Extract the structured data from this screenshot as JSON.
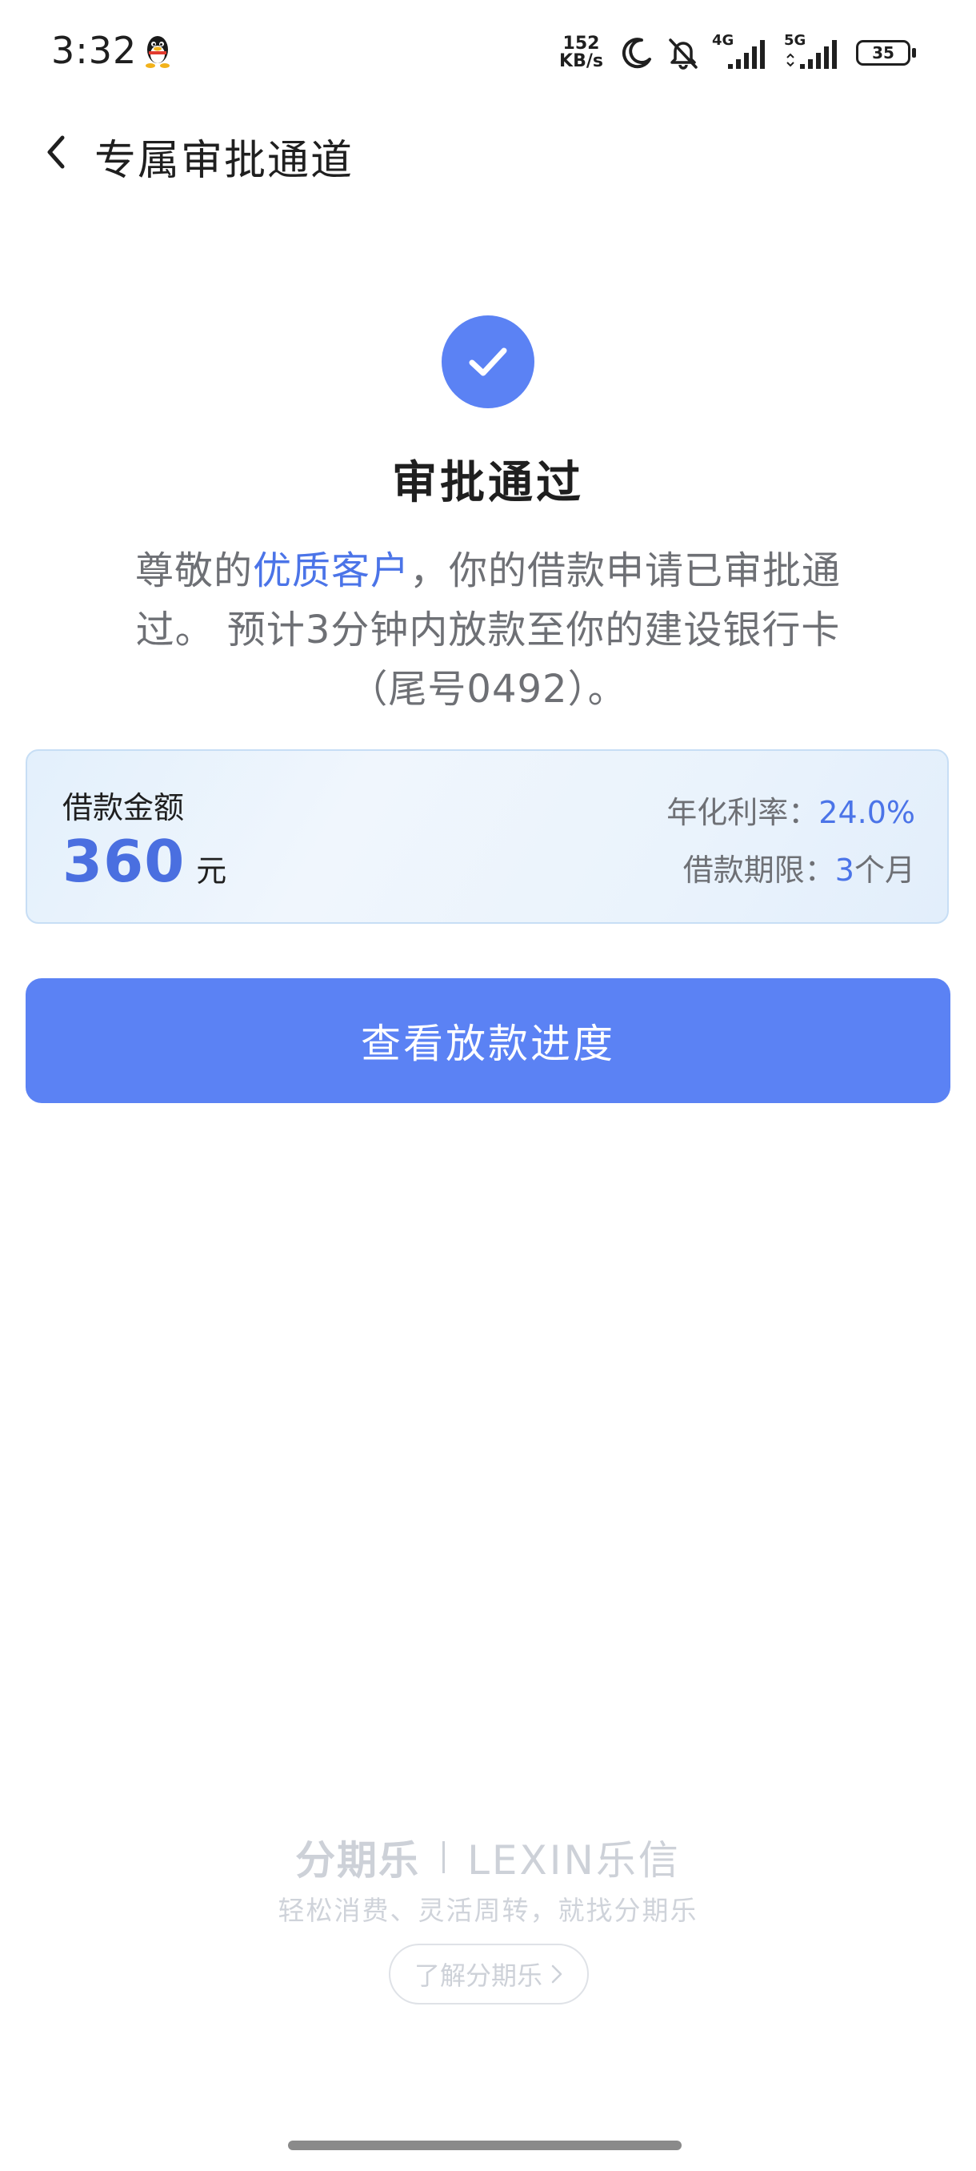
{
  "status_bar": {
    "time": "3:32",
    "net_speed_value": "152",
    "net_speed_unit": "KB/s",
    "signal_1_label": "4G",
    "signal_2_label": "5G",
    "battery": "35",
    "icons": [
      "qq-icon",
      "moon-icon",
      "bell-off-icon",
      "signal-icon",
      "signal-icon",
      "battery-icon"
    ]
  },
  "header": {
    "title": "专属审批通道"
  },
  "result": {
    "title": "审批通过",
    "desc_prefix": "尊敬的",
    "desc_highlight": "优质客户",
    "desc_suffix": "，你的借款申请已审批通过。 预计3分钟内放款至你的建设银行卡（尾号0492）。"
  },
  "loan": {
    "label": "借款金额",
    "amount": "360",
    "unit": "元",
    "rate_label": "年化利率：",
    "rate_value": "24.0%",
    "term_label": "借款期限：",
    "term_value": "3",
    "term_unit": "个月"
  },
  "primary_button": {
    "label": "查看放款进度"
  },
  "footer": {
    "brand_left": "分期乐",
    "brand_right": "LEXIN乐信",
    "slogan": "轻松消费、灵活周转，就找分期乐",
    "learn_more": "了解分期乐"
  },
  "colors": {
    "accent": "#5b82f4",
    "highlight_text": "#4b74e8",
    "card_border": "#c7def5"
  }
}
